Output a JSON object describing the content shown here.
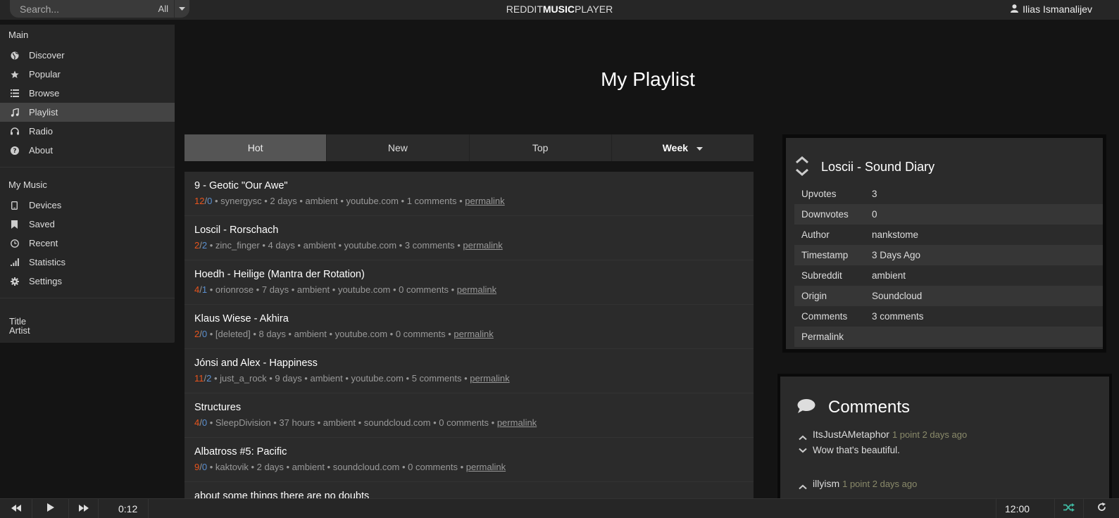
{
  "search": {
    "placeholder": "Search...",
    "filter": "All"
  },
  "brand": {
    "part1": "REDDIT",
    "part2": "MUSIC",
    "part3": "PLAYER"
  },
  "user": {
    "name": "Ilias Ismanalijev",
    "icon": "user-icon"
  },
  "sidebar": {
    "main_title": "Main",
    "main": [
      {
        "label": "Discover",
        "icon": "globe-icon"
      },
      {
        "label": "Popular",
        "icon": "star-icon"
      },
      {
        "label": "Browse",
        "icon": "list-icon"
      },
      {
        "label": "Playlist",
        "icon": "music-icon"
      },
      {
        "label": "Radio",
        "icon": "headphones-icon"
      },
      {
        "label": "About",
        "icon": "question-icon"
      }
    ],
    "mymusic_title": "My Music",
    "mymusic": [
      {
        "label": "Devices",
        "icon": "device-icon"
      },
      {
        "label": "Saved",
        "icon": "bookmark-icon"
      },
      {
        "label": "Recent",
        "icon": "clock-icon"
      },
      {
        "label": "Statistics",
        "icon": "signal-icon"
      },
      {
        "label": "Settings",
        "icon": "gear-icon"
      }
    ],
    "now_playing": {
      "title": "Title",
      "artist": "Artist"
    }
  },
  "page_title": "My Playlist",
  "tabs": {
    "hot": "Hot",
    "new": "New",
    "top": "Top",
    "period": "Week"
  },
  "songs": [
    {
      "title": "9 - Geotic \"Our Awe\"",
      "up": "12",
      "down": "0",
      "info": "synergysc • 2 days • ambient • youtube.com • 1 comments • ",
      "perma": "permalink"
    },
    {
      "title": "Loscil - Rorschach",
      "up": "2",
      "down": "2",
      "info": "zinc_finger • 4 days • ambient • youtube.com • 3 comments • ",
      "perma": "permalink"
    },
    {
      "title": "Hoedh - Heilige (Mantra der Rotation)",
      "up": "4",
      "down": "1",
      "info": "orionrose • 7 days • ambient • youtube.com • 0 comments • ",
      "perma": "permalink"
    },
    {
      "title": "Klaus Wiese - Akhira",
      "up": "2",
      "down": "0",
      "info": "[deleted] • 8 days • ambient • youtube.com • 0 comments • ",
      "perma": "permalink"
    },
    {
      "title": "Jónsi and Alex - Happiness",
      "up": "11",
      "down": "2",
      "info": "just_a_rock • 9 days • ambient • youtube.com • 5 comments • ",
      "perma": "permalink"
    },
    {
      "title": "Structures",
      "up": "4",
      "down": "0",
      "info": "SleepDivision • 37 hours • ambient • soundcloud.com • 0 comments • ",
      "perma": "permalink"
    },
    {
      "title": "Albatross #5: Pacific",
      "up": "9",
      "down": "0",
      "info": "kaktovik • 2 days • ambient • soundcloud.com • 0 comments • ",
      "perma": "permalink"
    },
    {
      "title": "about some things there are no doubts",
      "up": "",
      "down": "",
      "info": "",
      "perma": ""
    }
  ],
  "info": {
    "title": "Loscii - Sound Diary",
    "rows": [
      {
        "key": "Upvotes",
        "value": "3"
      },
      {
        "key": "Downvotes",
        "value": "0"
      },
      {
        "key": "Author",
        "value": "nankstome"
      },
      {
        "key": "Timestamp",
        "value": "3 Days Ago"
      },
      {
        "key": "Subreddit",
        "value": "ambient"
      },
      {
        "key": "Origin",
        "value": "Soundcloud"
      },
      {
        "key": "Comments",
        "value": "3 comments"
      },
      {
        "key": "Permalink",
        "value": ""
      }
    ]
  },
  "comments": {
    "title": "Comments",
    "items": [
      {
        "author": "ItsJustAMetaphor",
        "points": "1 point 2 days ago",
        "body": "Wow that's beautiful."
      },
      {
        "author": "illyism",
        "points": "1 point 2 days ago",
        "body": ""
      }
    ]
  },
  "player": {
    "elapsed": "0:12",
    "total": "12:00"
  },
  "colors": {
    "upvote": "#e8541d",
    "downvote": "#5a8fd0",
    "shuffle": "#3fb8a0"
  }
}
